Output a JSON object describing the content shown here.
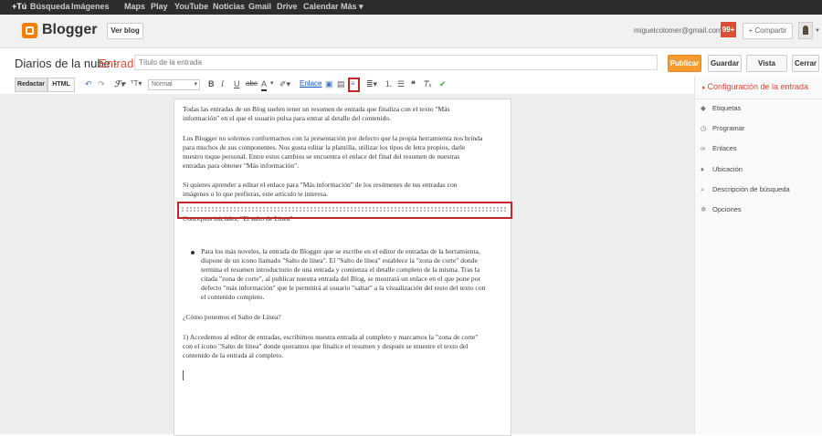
{
  "gbar": {
    "items": [
      "+Tú",
      "Búsqueda",
      "Imágenes",
      "Maps",
      "Play",
      "YouTube",
      "Noticias",
      "Gmail",
      "Drive",
      "Calendar",
      "Más ▾"
    ]
  },
  "header": {
    "logo_text": "Blogger",
    "ver_blog": "Ver blog",
    "email": "miguelcolomer@gmail.com",
    "notifications": "99+",
    "share": "+ Compartir"
  },
  "titlebar": {
    "blog_name": "Diarios de la nube ·",
    "section": "Entrada",
    "title_placeholder": "Título de la entrada",
    "publish": "Publicar",
    "save": "Guardar",
    "preview": "Vista previa",
    "close": "Cerrar"
  },
  "toolbar": {
    "compose": "Redactar",
    "html": "HTML",
    "font_size": "Normal",
    "link": "Enlace"
  },
  "sidebar": {
    "header": "Configuración de la entrada",
    "items": [
      {
        "label": "Etiquetas",
        "icon": "tag-icon"
      },
      {
        "label": "Programar",
        "icon": "clock-icon"
      },
      {
        "label": "Enlaces",
        "icon": "link-icon"
      },
      {
        "label": "Ubicación",
        "icon": "pin-icon"
      },
      {
        "label": "Descripción de búsqueda",
        "icon": "search-icon"
      },
      {
        "label": "Opciones",
        "icon": "gear-icon"
      }
    ]
  },
  "content": {
    "lines": [
      "Todas las entradas de un Blog suelen tener un resumen de entrada que finaliza con el texto \"Más",
      "información\" en el que el usuario pulsa para entrar al detalle del contenido.",
      "Los Blogger no solemos conformarnos con la presentación por defecto que la propia herramienta nos brinda",
      "para muchos de sus componentes. Nos gusta editar la plantilla, utilizar los tipos de letra propios, darle",
      "nuestro toque personal. Entre estos cambios se encuentra el enlace del final del resumen de nuestras",
      "entradas para obtener \"Más información\".",
      "Si quieres aprender a editar el enlace para \"Más información\" de los resúmenes de tus entradas con",
      "imágenes o lo que prefieras, este artículo te interesa.",
      "Conceptos iniciales, \"El salto de Línea\"",
      "Para los más noveles, la entrada de Blogger que se escribe en el editor de entradas de la herramienta,",
      "dispone de un icono llamado \"Salto de línea\". El \"Salto de línea\" establece la \"zona de corte\" donde",
      "termina el resumen introductorio de una entrada y comienza el detalle completo de la misma. Tras la",
      "citada \"zona de corte\", al publicar nuestra entrada del Blog, se mostrará un enlace en el que pone por",
      "defecto \"más información\" que le permitirá al usuario \"saltar\" a la visualización del resto del texto con",
      "el contenido completo.",
      "¿Cómo ponemos el Salto de Línea?",
      "1) Accedemos al editor de entradas, escribimos nuestra entrada al completo y marcamos la \"zona de corte\"",
      "con el icono \"Salto de línea\" donde queramos que finalice el resumen y después se muestre el texto del",
      "contenido de la entrada al completo."
    ]
  }
}
